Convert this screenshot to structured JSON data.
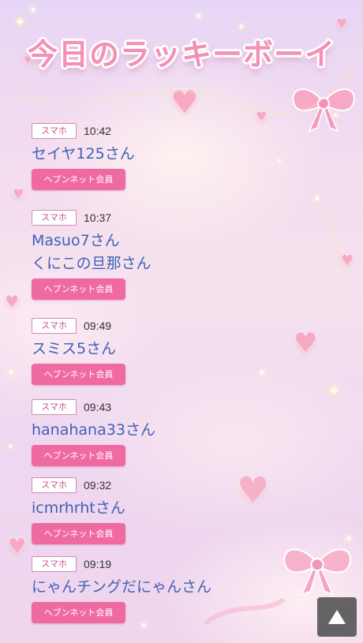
{
  "header": {
    "title": "今日のラッキーボーイ"
  },
  "entries": [
    {
      "device": "スマホ",
      "time": "10:42",
      "names": [
        "セイヤ125さん"
      ],
      "badge": "ヘブンネット会員"
    },
    {
      "device": "スマホ",
      "time": "10:37",
      "names": [
        "Masuo7さん",
        "くにこの旦那さん"
      ],
      "badge": "ヘブンネット会員"
    },
    {
      "device": "スマホ",
      "time": "09:49",
      "names": [
        "スミス5さん"
      ],
      "badge": "ヘブンネット会員"
    },
    {
      "device": "スマホ",
      "time": "09:43",
      "names": [
        "hanahana33さん"
      ],
      "badge": "ヘブンネット会員"
    },
    {
      "device": "スマホ",
      "time": "09:32",
      "names": [
        "icmrhrhtさん"
      ],
      "badge": "ヘブンネット会員"
    },
    {
      "device": "スマホ",
      "time": "09:19",
      "names": [
        "にゃんチングだにゃんさん"
      ],
      "badge": "ヘブンネット会員"
    }
  ],
  "back_to_top": {
    "icon": "up-triangle-icon"
  },
  "colors": {
    "title_pink": "#f390b5",
    "device_tag_border": "#d08bb5",
    "device_tag_text": "#c05390",
    "name_blue": "#3f62b8",
    "badge_pink": "#f06aa2",
    "back_to_top_bg": "#555555"
  }
}
